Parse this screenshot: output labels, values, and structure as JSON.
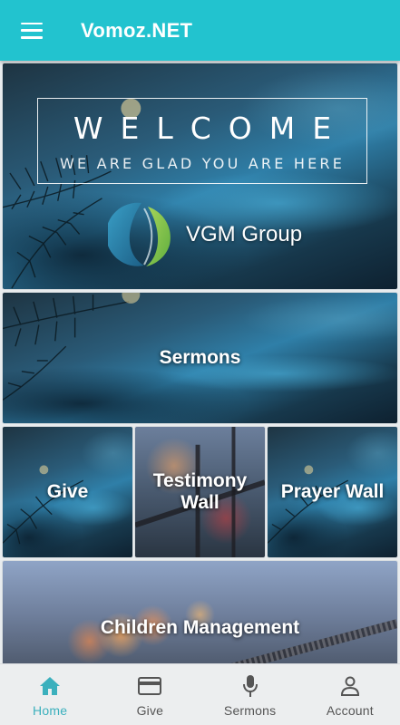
{
  "appbar": {
    "title": "Vomoz.NET",
    "background": "#22c3cf",
    "menu_icon": "hamburger-menu-icon"
  },
  "welcome": {
    "title": "WELCOME",
    "subtitle": "WE ARE GLAD YOU ARE HERE",
    "org_name": "VGM Group",
    "logo_icon": "vgm-group-logo"
  },
  "tiles": {
    "sermons": "Sermons",
    "give": "Give",
    "testimony_wall": "Testimony Wall",
    "prayer_wall": "Prayer Wall",
    "children_management": "Children Management"
  },
  "bottom_nav": {
    "active_color": "#3bb0bd",
    "items": [
      {
        "label": "Home",
        "icon": "home-icon",
        "active": true
      },
      {
        "label": "Give",
        "icon": "credit-card-icon",
        "active": false
      },
      {
        "label": "Sermons",
        "icon": "microphone-icon",
        "active": false
      },
      {
        "label": "Account",
        "icon": "person-icon",
        "active": false
      }
    ]
  }
}
